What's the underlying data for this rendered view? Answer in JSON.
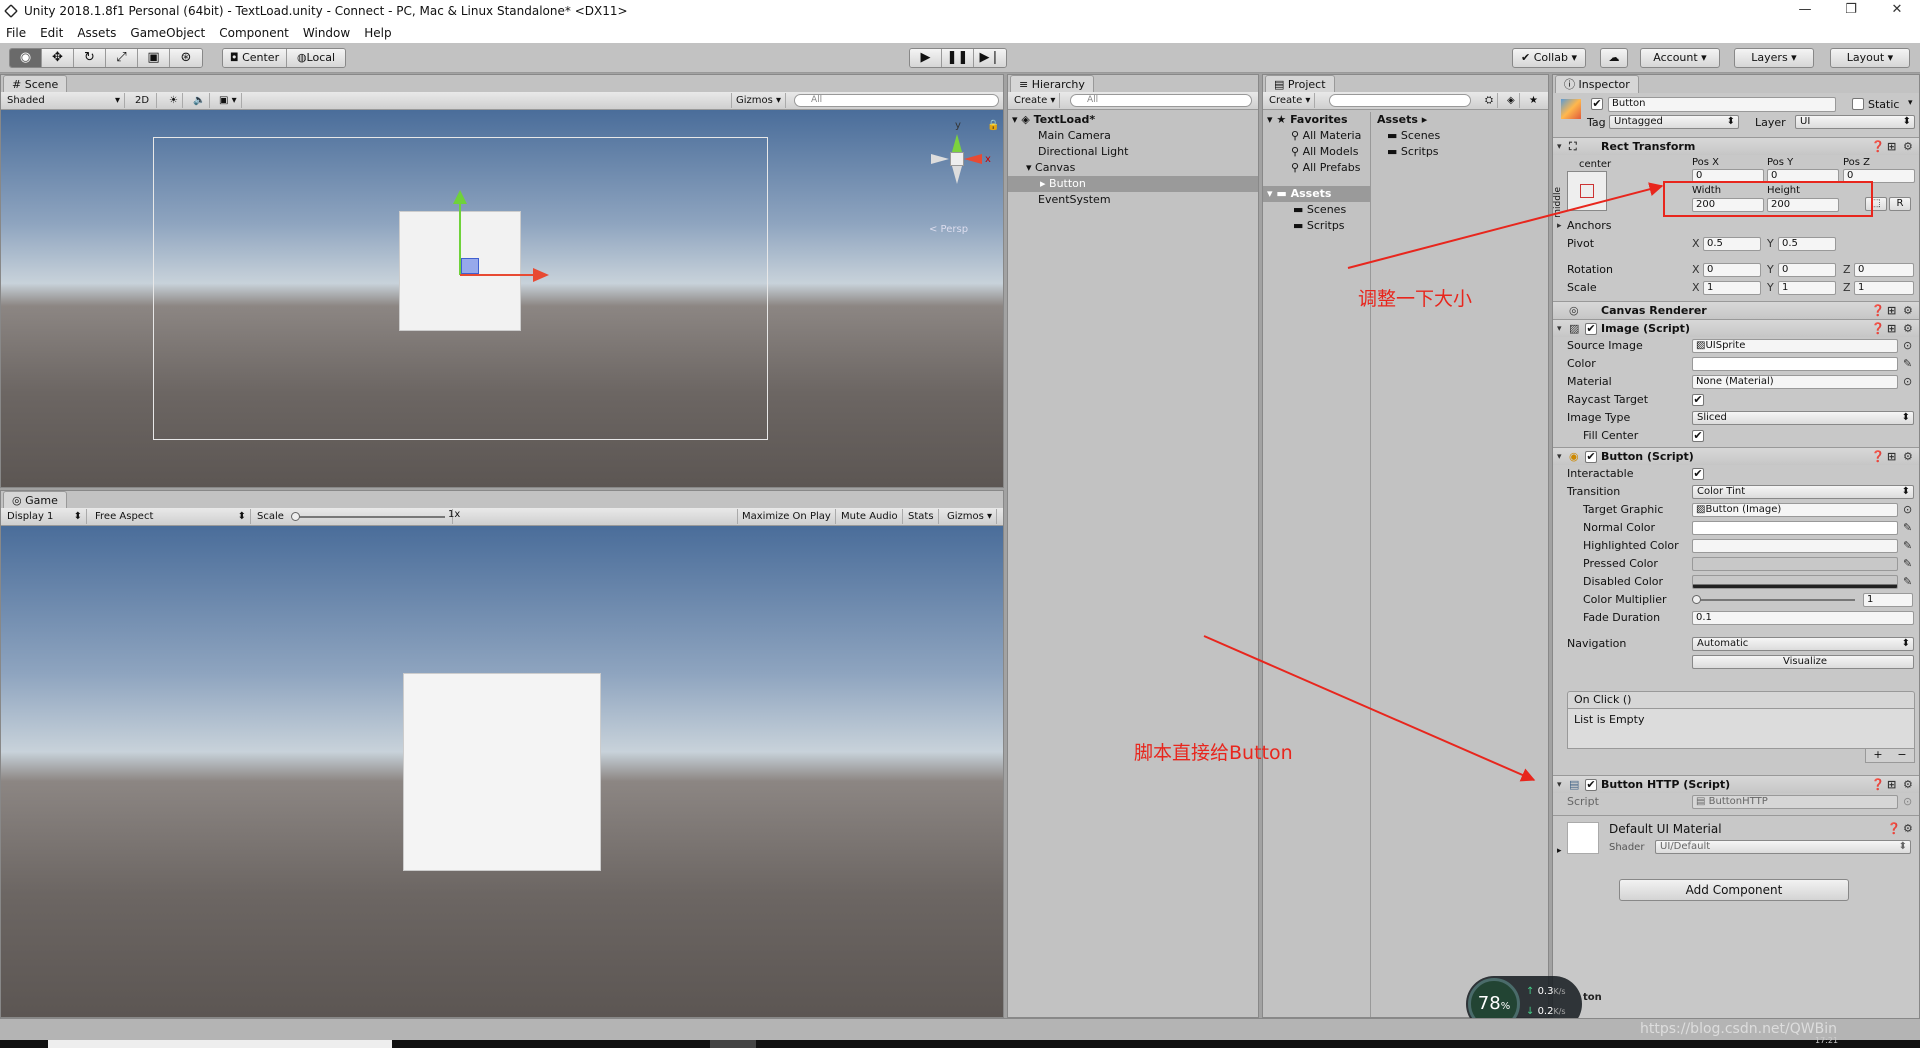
{
  "window": {
    "title": "Unity 2018.1.8f1 Personal (64bit) - TextLoad.unity - Connect - PC, Mac & Linux Standalone* <DX11>",
    "controls": [
      "—",
      "❐",
      "✕"
    ]
  },
  "menu": [
    "File",
    "Edit",
    "Assets",
    "GameObject",
    "Component",
    "Window",
    "Help"
  ],
  "toolbar": {
    "pivot": "Center",
    "space": "Local",
    "collab": "Collab ▾",
    "account": "Account",
    "layers": "Layers",
    "layout": "Layout"
  },
  "scene": {
    "tab": "Scene",
    "shading": "Shaded",
    "mode2d": "2D",
    "gizmos": "Gizmos ▾",
    "search_placeholder": "All",
    "gizmo_y": "y",
    "gizmo_x": "x",
    "persp": "< Persp"
  },
  "game": {
    "tab": "Game",
    "display": "Display 1",
    "aspect": "Free Aspect",
    "scale_label": "Scale",
    "scale_value": "1x",
    "buttons": [
      "Maximize On Play",
      "Mute Audio",
      "Stats",
      "Gizmos ▾"
    ]
  },
  "hierarchy": {
    "tab": "Hierarchy",
    "create": "Create ▾",
    "search_placeholder": "All",
    "scene_name": "TextLoad*",
    "items": [
      "Main Camera",
      "Directional Light",
      "Canvas",
      "Button",
      "EventSystem"
    ]
  },
  "project": {
    "tab": "Project",
    "create": "Create ▾",
    "favorites_label": "Favorites",
    "favorites": [
      "All Materia",
      "All Models",
      "All Prefabs"
    ],
    "assets_label": "Assets",
    "assets_folders": [
      "Scenes",
      "Scritps"
    ],
    "breadcrumb": "Assets ▸",
    "right_folders": [
      "Scenes",
      "Scritps"
    ]
  },
  "inspector": {
    "tab": "Inspector",
    "object_name": "Button",
    "static_label": "Static",
    "tag_label": "Tag",
    "tag_value": "Untagged",
    "layer_label": "Layer",
    "layer_value": "UI",
    "rect": {
      "title": "Rect Transform",
      "anchor_top": "center",
      "anchor_side": "middle",
      "posx_label": "Pos X",
      "posx": "0",
      "posy_label": "Pos Y",
      "posy": "0",
      "posz_label": "Pos Z",
      "posz": "0",
      "width_label": "Width",
      "width": "200",
      "height_label": "Height",
      "height": "200",
      "r_button": "R",
      "anchors": "Anchors",
      "pivot_label": "Pivot",
      "pivot_x": "0.5",
      "pivot_y": "0.5",
      "rotation_label": "Rotation",
      "rot_x": "0",
      "rot_y": "0",
      "rot_z": "0",
      "scale_label": "Scale",
      "scale_x": "1",
      "scale_y": "1",
      "scale_z": "1",
      "axis_x": "X",
      "axis_y": "Y",
      "axis_z": "Z"
    },
    "canvas_renderer": "Canvas Renderer",
    "image": {
      "title": "Image (Script)",
      "source_image_label": "Source Image",
      "source_image": "UISprite",
      "color_label": "Color",
      "material_label": "Material",
      "material": "None (Material)",
      "raycast_label": "Raycast Target",
      "image_type_label": "Image Type",
      "image_type": "Sliced",
      "fill_center_label": "Fill Center"
    },
    "button": {
      "title": "Button (Script)",
      "interactable_label": "Interactable",
      "transition_label": "Transition",
      "transition": "Color Tint",
      "target_graphic_label": "Target Graphic",
      "target_graphic": "Button (Image)",
      "normal_label": "Normal Color",
      "highlighted_label": "Highlighted Color",
      "pressed_label": "Pressed Color",
      "disabled_label": "Disabled Color",
      "multiplier_label": "Color Multiplier",
      "multiplier": "1",
      "fade_label": "Fade Duration",
      "fade": "0.1",
      "navigation_label": "Navigation",
      "navigation": "Automatic",
      "visualize": "Visualize",
      "onclick": "On Click ()",
      "list_empty": "List is Empty",
      "plus": "+",
      "minus": "−"
    },
    "button_http": {
      "title": "Button HTTP (Script)",
      "script_label": "Script",
      "script": "ButtonHTTP"
    },
    "material": {
      "name": "Default UI Material",
      "shader_label": "Shader",
      "shader": "UI/Default"
    },
    "add_component": "Add Component"
  },
  "annotations": {
    "resize": "调整一下大小",
    "script": "脚本直接给Button"
  },
  "net_widget": {
    "percent": "78",
    "unit": "%",
    "up": "0.3",
    "down": "0.2",
    "rate_unit": "K/s"
  },
  "status": {
    "partial": "ton",
    "watermark": "https://blog.csdn.net/QWBin",
    "clock": "17:21"
  },
  "colors": {
    "annotation": "#e8261d",
    "selection": "#9a9a9a",
    "panel": "#c2c2c2"
  }
}
